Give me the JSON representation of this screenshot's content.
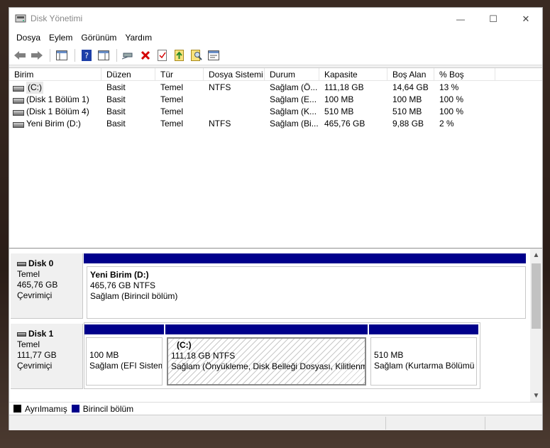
{
  "window": {
    "title": "Disk Yönetimi"
  },
  "window_controls": {
    "minimize": "—",
    "maximize": "☐",
    "close": "✕"
  },
  "menu": [
    "Dosya",
    "Eylem",
    "Görünüm",
    "Yardım"
  ],
  "toolbar": [
    "back-icon",
    "forward-icon",
    "panel-icon",
    "help-icon",
    "panel2-icon",
    "connect-icon",
    "delete-icon",
    "check-icon",
    "export-icon",
    "search-icon",
    "properties-icon"
  ],
  "columns": [
    "Birim",
    "Düzen",
    "Tür",
    "Dosya Sistemi",
    "Durum",
    "Kapasite",
    "Boş Alan",
    "% Boş"
  ],
  "volumes": [
    {
      "name": "(C:)",
      "layout": "Basit",
      "type": "Temel",
      "fs": "NTFS",
      "status": "Sağlam (Ö...",
      "capacity": "111,18 GB",
      "free": "14,64 GB",
      "pct": "13 %"
    },
    {
      "name": "(Disk 1 Bölüm 1)",
      "layout": "Basit",
      "type": "Temel",
      "fs": "",
      "status": "Sağlam (E...",
      "capacity": "100 MB",
      "free": "100 MB",
      "pct": "100 %"
    },
    {
      "name": "(Disk 1 Bölüm 4)",
      "layout": "Basit",
      "type": "Temel",
      "fs": "",
      "status": "Sağlam (K...",
      "capacity": "510 MB",
      "free": "510 MB",
      "pct": "100 %"
    },
    {
      "name": "Yeni Birim (D:)",
      "layout": "Basit",
      "type": "Temel",
      "fs": "NTFS",
      "status": "Sağlam (Bi...",
      "capacity": "465,76 GB",
      "free": "9,88 GB",
      "pct": "2 %"
    }
  ],
  "disks": [
    {
      "name": "Disk 0",
      "type": "Temel",
      "size": "465,76 GB",
      "state": "Çevrimiçi",
      "partitions": [
        {
          "title": "Yeni Birim  (D:)",
          "size": "465,76 GB NTFS",
          "status": "Sağlam (Birincil bölüm)"
        }
      ]
    },
    {
      "name": "Disk 1",
      "type": "Temel",
      "size": "111,77 GB",
      "state": "Çevrimiçi",
      "partitions": [
        {
          "title": "",
          "size": "100 MB",
          "status": "Sağlam (EFI Sistem"
        },
        {
          "title": "(C:)",
          "size": "111,18 GB NTFS",
          "status": "Sağlam (Önyükleme, Disk Belleği Dosyası, Kilitlenme"
        },
        {
          "title": "",
          "size": "510 MB",
          "status": "Sağlam (Kurtarma Bölümü"
        }
      ]
    }
  ],
  "legend": [
    {
      "label": "Ayrılmamış",
      "color": "#000000"
    },
    {
      "label": "Birincil bölüm",
      "color": "#00008b"
    }
  ],
  "colors": {
    "partition_header": "#00008b"
  },
  "scroll": {
    "up": "▲",
    "down": "▼"
  }
}
